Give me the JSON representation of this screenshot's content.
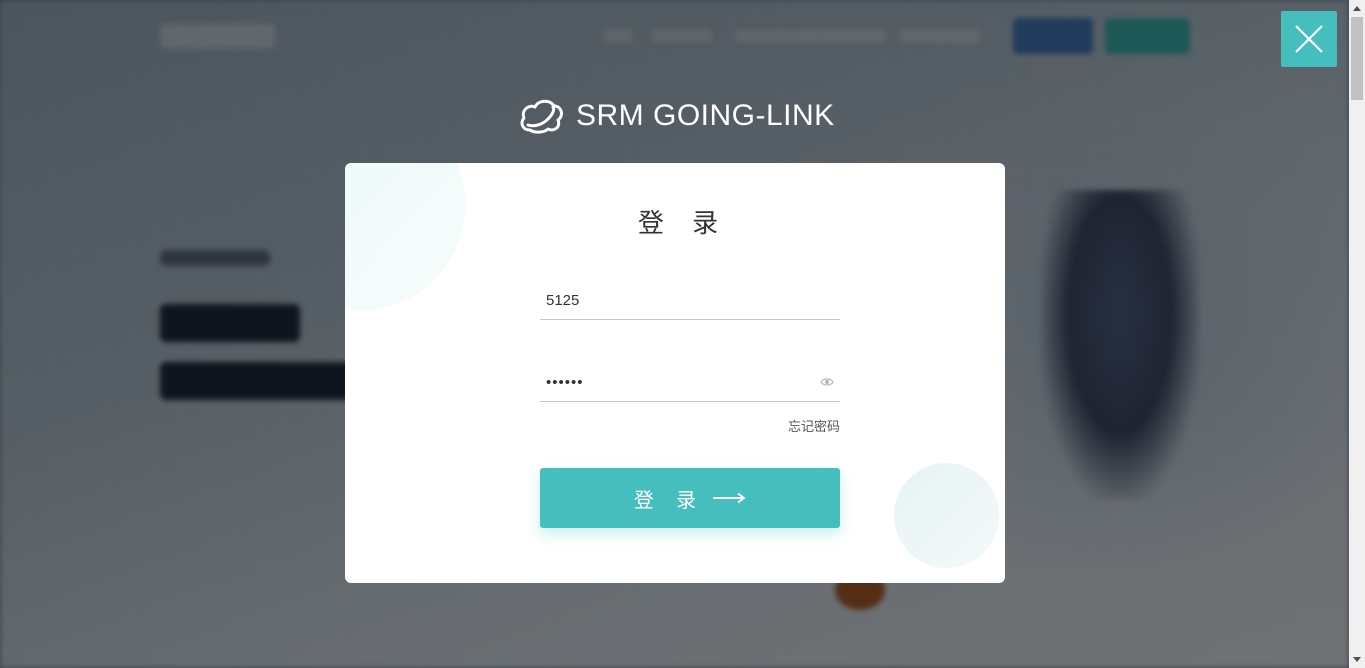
{
  "brand": {
    "name": "SRM GOING-LINK",
    "logo_icon": "cloud-logo-icon"
  },
  "dialog": {
    "title": "登 录",
    "close_icon": "close-icon"
  },
  "form": {
    "username": {
      "value": "5125"
    },
    "password": {
      "value": "••••••",
      "visibility_icon": "eye-icon"
    },
    "forgot_password": "忘记密码",
    "submit": {
      "label": "登 录",
      "icon": "arrow-right-icon"
    }
  },
  "colors": {
    "accent": "#45bebd",
    "overlay": "rgba(0,0,0,0.48)",
    "dialog_bg": "#ffffff",
    "title_text": "#333333",
    "link_text": "#555555"
  }
}
